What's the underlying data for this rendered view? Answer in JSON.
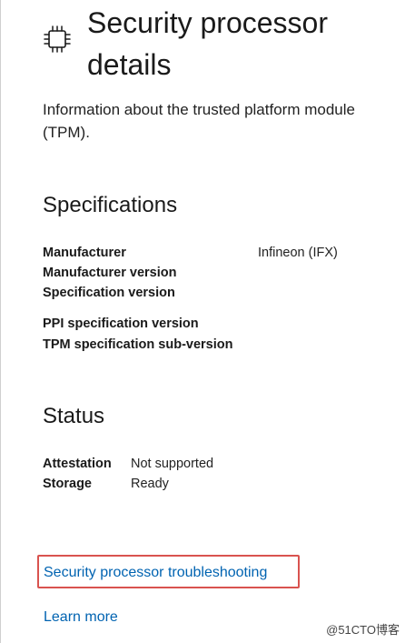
{
  "header": {
    "title_line1": "Security processor",
    "title_line2": "details",
    "icon": "processor-chip-icon"
  },
  "description": "Information about the trusted platform module (TPM).",
  "specifications": {
    "heading": "Specifications",
    "manufacturer_label": "Manufacturer",
    "manufacturer_value": "Infineon (IFX)",
    "manufacturer_version_label": "Manufacturer version",
    "specification_version_label": "Specification version",
    "ppi_version_label": "PPI specification version",
    "tpm_sub_version_label": "TPM specification sub-version"
  },
  "status": {
    "heading": "Status",
    "attestation_label": "Attestation",
    "attestation_value": "Not supported",
    "storage_label": "Storage",
    "storage_value": "Ready"
  },
  "links": {
    "troubleshooting": "Security processor troubleshooting",
    "learn_more": "Learn more"
  },
  "watermark": "@51CTO博客",
  "colors": {
    "link": "#0063b1",
    "highlight": "#d9534f"
  }
}
